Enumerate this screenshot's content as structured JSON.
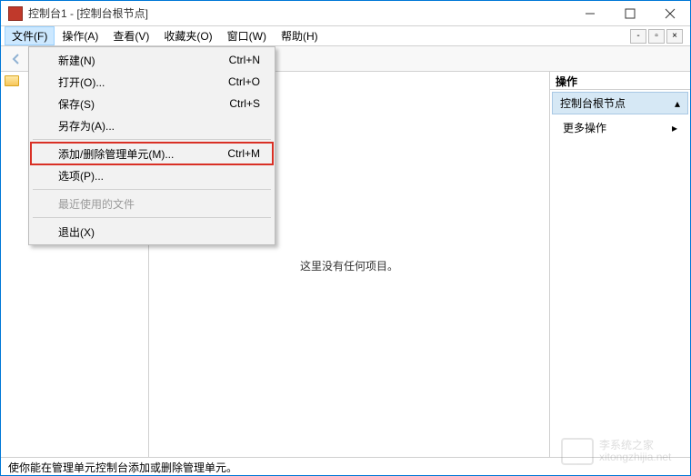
{
  "window": {
    "title": "控制台1 - [控制台根节点]"
  },
  "menubar": {
    "file": "文件(F)",
    "action": "操作(A)",
    "view": "查看(V)",
    "favorites": "收藏夹(O)",
    "window": "窗口(W)",
    "help": "帮助(H)"
  },
  "dropdown": {
    "new": {
      "label": "新建(N)",
      "shortcut": "Ctrl+N"
    },
    "open": {
      "label": "打开(O)...",
      "shortcut": "Ctrl+O"
    },
    "save": {
      "label": "保存(S)",
      "shortcut": "Ctrl+S"
    },
    "saveas": {
      "label": "另存为(A)...",
      "shortcut": ""
    },
    "addremove": {
      "label": "添加/删除管理单元(M)...",
      "shortcut": "Ctrl+M"
    },
    "options": {
      "label": "选项(P)...",
      "shortcut": ""
    },
    "recent": {
      "label": "最近使用的文件",
      "shortcut": ""
    },
    "exit": {
      "label": "退出(X)",
      "shortcut": ""
    }
  },
  "center": {
    "empty": "这里没有任何项目。"
  },
  "rightpane": {
    "header": "操作",
    "rootnode": "控制台根节点",
    "more": "更多操作"
  },
  "statusbar": {
    "text": "使你能在管理单元控制台添加或删除管理单元。"
  },
  "watermark": {
    "line1": "李系统之家",
    "line2": "xitongzhijia.net"
  }
}
